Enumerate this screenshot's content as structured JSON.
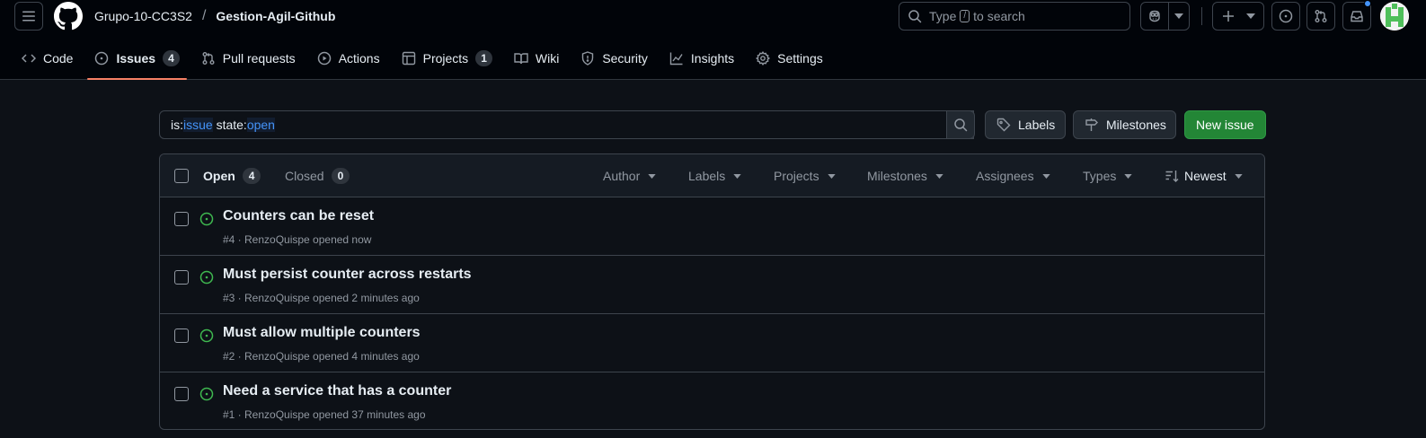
{
  "header": {
    "owner": "Grupo-10-CC3S2",
    "separator": "/",
    "repo": "Gestion-Agil-Github",
    "search": {
      "prefix": "Type",
      "key": "/",
      "suffix": "to search"
    },
    "icons": [
      "hamburger-icon",
      "github-logo",
      "search-icon",
      "copilot-icon",
      "plus-icon",
      "issue-opened-icon",
      "pull-request-icon",
      "inbox-icon"
    ],
    "notification_color": "#4493f8"
  },
  "nav": {
    "items": [
      {
        "label": "Code",
        "icon": "code-icon"
      },
      {
        "label": "Issues",
        "icon": "issue-opened-icon",
        "count": "4",
        "active": true
      },
      {
        "label": "Pull requests",
        "icon": "pull-request-icon"
      },
      {
        "label": "Actions",
        "icon": "play-icon"
      },
      {
        "label": "Projects",
        "icon": "table-icon",
        "count": "1"
      },
      {
        "label": "Wiki",
        "icon": "book-icon"
      },
      {
        "label": "Security",
        "icon": "shield-icon"
      },
      {
        "label": "Insights",
        "icon": "graph-icon"
      },
      {
        "label": "Settings",
        "icon": "gear-icon"
      }
    ],
    "active_color": "#f78166"
  },
  "filter": {
    "p1": "is:",
    "v1": "issue",
    "p2": " state:",
    "v2": "open",
    "labels_button": "Labels",
    "milestones_button": "Milestones",
    "new_issue_button": "New issue",
    "new_issue_color": "#238636"
  },
  "issues_box": {
    "open_label": "Open",
    "open_count": "4",
    "closed_label": "Closed",
    "closed_count": "0",
    "filters": [
      "Author",
      "Labels",
      "Projects",
      "Milestones",
      "Assignees",
      "Types"
    ],
    "sort": "Newest",
    "open_icon_color": "#3fb950"
  },
  "issues": [
    {
      "title": "Counters can be reset",
      "meta": "#4 · RenzoQuispe opened now"
    },
    {
      "title": "Must persist counter across restarts",
      "meta": "#3 · RenzoQuispe opened 2 minutes ago"
    },
    {
      "title": "Must allow multiple counters",
      "meta": "#2 · RenzoQuispe opened 4 minutes ago"
    },
    {
      "title": "Need a service that has a counter",
      "meta": "#1 · RenzoQuispe opened 37 minutes ago"
    }
  ]
}
